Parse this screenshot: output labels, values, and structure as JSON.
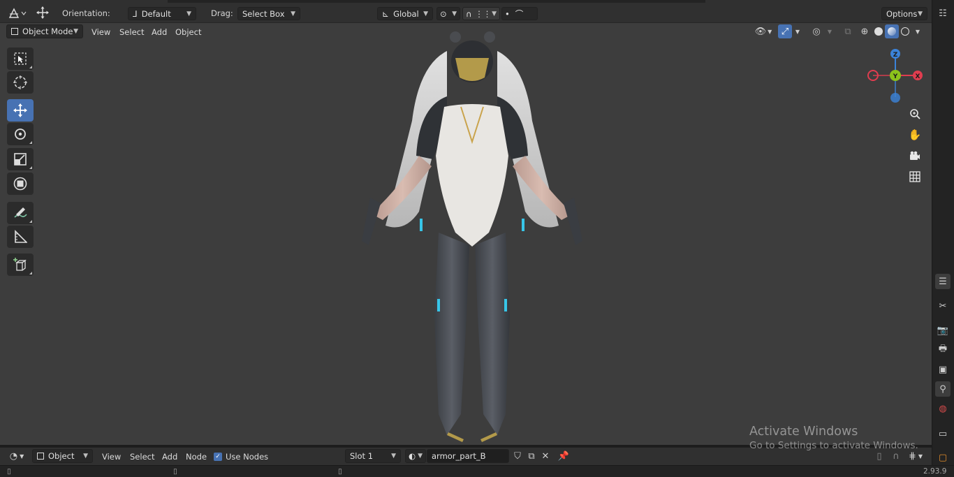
{
  "toolbar": {
    "orientation_label": "Orientation:",
    "orientation_value": "Default",
    "drag_label": "Drag:",
    "drag_value": "Select Box",
    "transform_space": "Global",
    "options_label": "Options"
  },
  "viewport_header": {
    "mode": "Object Mode",
    "menus": [
      "View",
      "Select",
      "Add",
      "Object"
    ]
  },
  "left_tools": [
    {
      "name": "select-box-tool",
      "icon": "select-box-icon",
      "active": false
    },
    {
      "name": "cursor-tool",
      "icon": "cursor-icon",
      "active": false
    },
    {
      "name": "move-tool",
      "icon": "move-icon",
      "active": true
    },
    {
      "name": "rotate-tool",
      "icon": "rotate-icon",
      "active": false
    },
    {
      "name": "scale-tool",
      "icon": "scale-icon",
      "active": false
    },
    {
      "name": "transform-tool",
      "icon": "transform-icon",
      "active": false
    },
    {
      "name": "annotate-tool",
      "icon": "annotate-icon",
      "active": false
    },
    {
      "name": "measure-tool",
      "icon": "measure-icon",
      "active": false
    },
    {
      "name": "add-cube-tool",
      "icon": "add-cube-icon",
      "active": false
    }
  ],
  "gizmo": {
    "x": "X",
    "y": "Y",
    "z": "Z",
    "x_color": "#e03d4f",
    "y_color": "#8bc21b",
    "z_color": "#3b83d9"
  },
  "bottom_header": {
    "editor_type": "Object",
    "menus": [
      "View",
      "Select",
      "Add",
      "Node"
    ],
    "use_nodes_label": "Use Nodes",
    "use_nodes_checked": true,
    "slot": "Slot 1",
    "material_name": "armor_part_B"
  },
  "status": {
    "version": "2.93.9"
  },
  "watermark": {
    "line1": "Activate Windows",
    "line2": "Go to Settings to activate Windows."
  },
  "colors": {
    "accent": "#4772b3",
    "viewport_bg": "#3d3d3d",
    "header_bg": "#303030"
  }
}
